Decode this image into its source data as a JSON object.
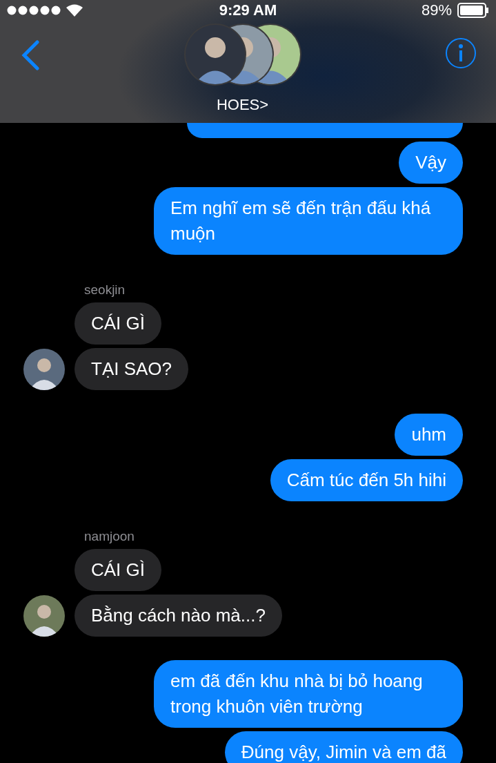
{
  "status_bar": {
    "time": "9:29 AM",
    "battery": "89%"
  },
  "header": {
    "title": "HOES>"
  },
  "messages": [
    {
      "kind": "sent",
      "bubbles": [
        {
          "kind": "clipped"
        },
        {
          "text": "Vậy"
        },
        {
          "text": "Em nghĩ em sẽ đến trận đấu khá muộn"
        }
      ]
    },
    {
      "kind": "received",
      "sender": "seokjin",
      "bubbles": [
        {
          "text": "CÁI GÌ"
        },
        {
          "text": "TẠI SAO?"
        }
      ]
    },
    {
      "kind": "sent",
      "bubbles": [
        {
          "text": "uhm"
        },
        {
          "text": "Cấm túc đến 5h hihi"
        }
      ]
    },
    {
      "kind": "received",
      "sender": "namjoon",
      "bubbles": [
        {
          "text": "CÁI GÌ"
        },
        {
          "text": "Bằng cách nào mà...?"
        }
      ]
    },
    {
      "kind": "sent",
      "bubbles": [
        {
          "text": "em đã đến khu nhà bị bỏ hoang trong khuôn viên trường"
        },
        {
          "text": "Đúng vậy, Jimin và em đã"
        }
      ]
    }
  ]
}
